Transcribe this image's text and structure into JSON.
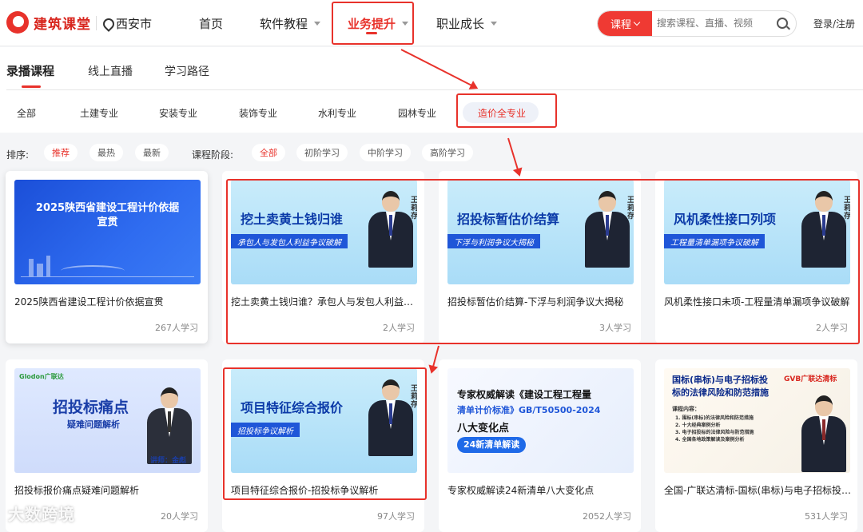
{
  "header": {
    "logo_text": "建筑课堂",
    "city": "西安市",
    "nav": [
      {
        "label": "首页"
      },
      {
        "label": "软件教程"
      },
      {
        "label": "业务提升"
      },
      {
        "label": "职业成长"
      }
    ],
    "search": {
      "type_label": "课程",
      "placeholder": "搜索课程、直播、视频"
    },
    "login": "登录/注册"
  },
  "tabs": [
    {
      "label": "录播课程"
    },
    {
      "label": "线上直播"
    },
    {
      "label": "学习路径"
    }
  ],
  "categories": [
    {
      "label": "全部"
    },
    {
      "label": "土建专业"
    },
    {
      "label": "安装专业"
    },
    {
      "label": "装饰专业"
    },
    {
      "label": "水利专业"
    },
    {
      "label": "园林专业"
    },
    {
      "label": "造价全专业"
    }
  ],
  "filters": {
    "sort_label": "排序:",
    "sort": [
      {
        "label": "推荐"
      },
      {
        "label": "最热"
      },
      {
        "label": "最新"
      }
    ],
    "stage_label": "课程阶段:",
    "stage": [
      {
        "label": "全部"
      },
      {
        "label": "初阶学习"
      },
      {
        "label": "中阶学习"
      },
      {
        "label": "高阶学习"
      }
    ]
  },
  "courses": [
    {
      "title": "2025陕西省建设工程计价依据宣贯",
      "count": "267人学习",
      "thumb": {
        "main": "2025陕西省建设工程计价依据",
        "main2": "宣贯"
      }
    },
    {
      "title": "挖土卖黄土钱归谁？承包人与发包人利益争议破解",
      "count": "2人学习",
      "thumb": {
        "main": "挖土卖黄土钱归谁",
        "sub": "承包人与发包人利益争议破解",
        "vname": "王莉存"
      }
    },
    {
      "title": "招投标暂估价结算-下浮与利润争议大揭秘",
      "count": "3人学习",
      "thumb": {
        "main": "招投标暂估价结算",
        "sub": "下浮与利润争议大揭秘",
        "vname": "王莉存"
      }
    },
    {
      "title": "风机柔性接口未项-工程量清单漏项争议破解",
      "count": "2人学习",
      "thumb": {
        "main": "风机柔性接口列项",
        "sub": "工程量清单漏项争议破解",
        "vname": "王莉存"
      }
    },
    {
      "title": "招投标报价痛点疑难问题解析",
      "count": "20人学习",
      "thumb": {
        "brand": "Glodon广联达",
        "main": "招投标痛点",
        "sub": "疑难问题解析",
        "lecturer": "讲师：金彪"
      }
    },
    {
      "title": "项目特征综合报价-招投标争议解析",
      "count": "97人学习",
      "thumb": {
        "main": "项目特征综合报价",
        "sub": "招投标争议解析",
        "vname": "王莉存"
      }
    },
    {
      "title": "专家权威解读24新清单八大变化点",
      "count": "2052人学习",
      "thumb": {
        "line1": "专家权威解读《建设工程工程量",
        "line2": "清单计价标准》GB/T50500-2024",
        "line3": "八大变化点",
        "badge": "24新清单解读"
      }
    },
    {
      "title": "全国-广联达清标-国标(串标)与电子招标投标的法律风险与防范措施",
      "count": "531人学习",
      "thumb": {
        "line1": "国标(串标)与电子招标投",
        "line2": "标的法律风险和防范措施",
        "brand": "GVB广联达清标",
        "content_label": "课程内容：",
        "points": [
          "1. 围标(串标)的法律风险和防范措施",
          "2. 十大经典案例分析",
          "3. 电子招投标的法律风险与防范措施",
          "4. 全国各地政策解读及案例分析"
        ]
      }
    }
  ],
  "watermark": "大数跨境",
  "colors": {
    "accent": "#e8322b",
    "blue": "#2f6cf0"
  }
}
